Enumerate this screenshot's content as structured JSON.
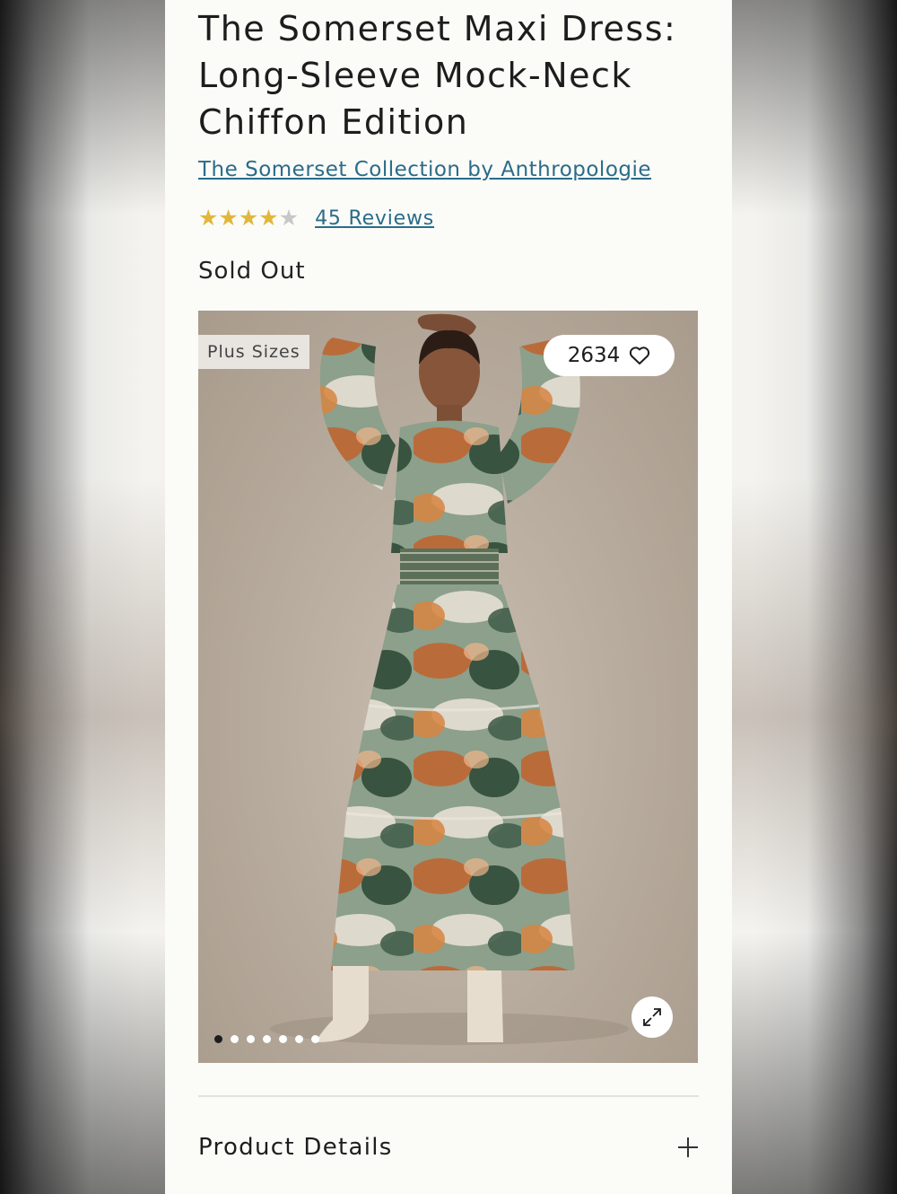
{
  "product": {
    "title": "The Somerset Maxi Dress: Long-Sleeve Mock-Neck Chiffon Edition",
    "collection_link": "The Somerset Collection by Anthropologie",
    "rating": 4,
    "rating_max": 5,
    "reviews_label": "45 Reviews",
    "stock_status": "Sold Out"
  },
  "gallery": {
    "badge": "Plus Sizes",
    "likes": "2634",
    "image_count": 7,
    "active_index": 0
  },
  "accordion": {
    "product_details_label": "Product Details"
  },
  "colors": {
    "link": "#2a6c8a",
    "star": "#e1b73b",
    "star_empty": "#c8c8c8"
  }
}
